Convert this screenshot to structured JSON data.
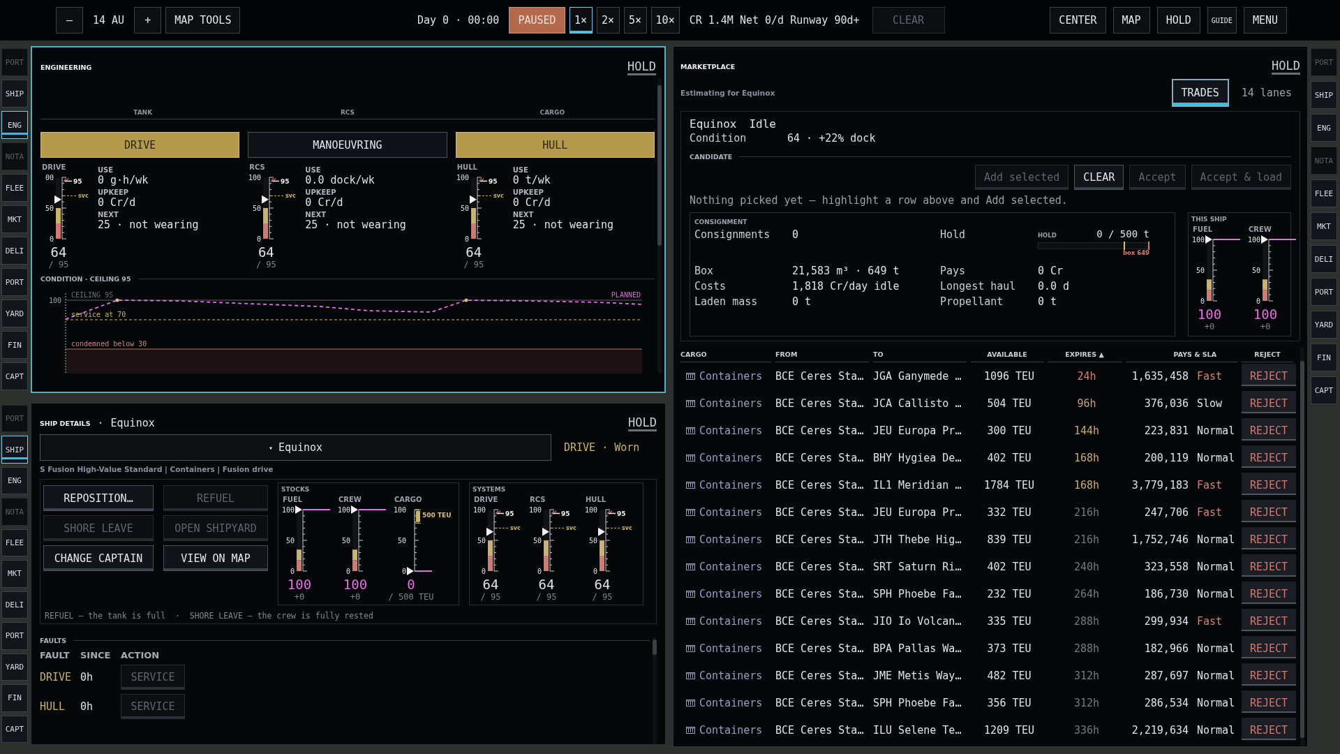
{
  "topbar": {
    "zoom_out": "–",
    "scale": "14 AU",
    "zoom_in": "+",
    "map_tools": "MAP TOOLS",
    "clock": "Day 0 · 00:00",
    "pause": {
      "label": "PAUSED",
      "on": true
    },
    "speeds": [
      {
        "label": "1×",
        "selected": true
      },
      {
        "label": "2×",
        "selected": false
      },
      {
        "label": "5×",
        "selected": false
      },
      {
        "label": "10×",
        "selected": false
      }
    ],
    "finance": "CR 1.4M Net 0/d Runway 90d+",
    "clear": {
      "label": "CLEAR",
      "disabled": true
    },
    "actions": [
      {
        "label": "CENTER",
        "kind": "normal"
      },
      {
        "label": "MAP",
        "kind": "normal"
      },
      {
        "label": "HOLD",
        "kind": "normal"
      },
      {
        "label": "GUIDE",
        "kind": "small"
      },
      {
        "label": "MENU",
        "kind": "normal"
      }
    ]
  },
  "left_sidebar_top": {
    "items": [
      {
        "label": "PORT",
        "disabled": true,
        "selected": false
      },
      {
        "label": "SHIP",
        "disabled": false,
        "selected": false
      },
      {
        "label": "ENG",
        "disabled": false,
        "selected": true
      },
      {
        "label": "NOTA",
        "disabled": true,
        "selected": false
      },
      {
        "label": "FLEE",
        "disabled": false,
        "selected": false
      },
      {
        "label": "MKT",
        "disabled": false,
        "selected": false
      },
      {
        "label": "DELI",
        "disabled": false,
        "selected": false
      },
      {
        "label": "PORT",
        "disabled": false,
        "selected": false
      },
      {
        "label": "YARD",
        "disabled": false,
        "selected": false
      },
      {
        "label": "FIN",
        "disabled": false,
        "selected": false
      },
      {
        "label": "CAPT",
        "disabled": false,
        "selected": false
      }
    ]
  },
  "engineering": {
    "title": "ENGINEERING",
    "hold": "HOLD",
    "focused": true,
    "columns": [
      "TANK",
      "RCS",
      "CARGO"
    ],
    "modes": [
      {
        "label": "DRIVE",
        "on": true
      },
      {
        "label": "MANOEUVRING",
        "on": false
      },
      {
        "label": "HULL",
        "on": true
      }
    ],
    "systems": [
      {
        "gauge": {
          "kind": "system",
          "label": "DRIVE",
          "ticks": [
            "00",
            "50",
            "0"
          ],
          "cap": "95",
          "service": "svc",
          "pointer": {
            "level": 0.64
          },
          "bar": {
            "level": 0.5
          },
          "value": "64",
          "sub": "/ 95"
        },
        "fields": [
          {
            "label": "USE",
            "value": "0 g·h/wk"
          },
          {
            "label": "UPKEEP",
            "value": "0 Cr/d"
          },
          {
            "label": "NEXT",
            "value": "25 · not wearing"
          }
        ]
      },
      {
        "gauge": {
          "kind": "system",
          "label": "RCS",
          "ticks": [
            "100",
            "50",
            "0"
          ],
          "cap": "95",
          "service": "svc",
          "pointer": {
            "level": 0.64
          },
          "bar": {
            "level": 0.5
          },
          "value": "64",
          "sub": "/ 95"
        },
        "fields": [
          {
            "label": "USE",
            "value": "0.0 dock/wk"
          },
          {
            "label": "UPKEEP",
            "value": "0 Cr/d"
          },
          {
            "label": "NEXT",
            "value": "25 · not wearing"
          }
        ]
      },
      {
        "gauge": {
          "kind": "system",
          "label": "HULL",
          "ticks": [
            "100",
            "50",
            "0"
          ],
          "cap": "95",
          "service": "svc",
          "pointer": {
            "level": 0.64
          },
          "bar": {
            "level": 0.5
          },
          "value": "64",
          "sub": "/ 95"
        },
        "fields": [
          {
            "label": "USE",
            "value": "0 t/wk"
          },
          {
            "label": "UPKEEP",
            "value": "0 Cr/d"
          },
          {
            "label": "NEXT",
            "value": "25 · not wearing"
          }
        ]
      }
    ],
    "condition": {
      "title": "CONDITION · CEILING 95",
      "axis_label": "100",
      "ceiling": "CEILING 95",
      "service": "service at 70",
      "condemned": "condemned below 30",
      "planned": "PLANNED"
    }
  },
  "left_sidebar_bottom": {
    "items": [
      {
        "label": "PORT",
        "disabled": true,
        "selected": false
      },
      {
        "label": "SHIP",
        "disabled": false,
        "selected": true
      },
      {
        "label": "ENG",
        "disabled": false,
        "selected": false
      },
      {
        "label": "NOTA",
        "disabled": true,
        "selected": false
      },
      {
        "label": "FLEE",
        "disabled": false,
        "selected": false
      },
      {
        "label": "MKT",
        "disabled": false,
        "selected": false
      },
      {
        "label": "DELI",
        "disabled": false,
        "selected": false
      },
      {
        "label": "PORT",
        "disabled": false,
        "selected": false
      },
      {
        "label": "YARD",
        "disabled": false,
        "selected": false
      },
      {
        "label": "FIN",
        "disabled": false,
        "selected": false
      },
      {
        "label": "CAPT",
        "disabled": false,
        "selected": false
      }
    ]
  },
  "ship_details": {
    "title": "SHIP DETAILS",
    "separator": "·",
    "name": "Equinox",
    "hold": "HOLD",
    "focused": false,
    "selector": {
      "caret": "▾",
      "value": "Equinox"
    },
    "status": "DRIVE · Worn",
    "subtitle": "S Fusion High-Value Standard | Containers | Fusion drive",
    "actions": [
      {
        "label": "REPOSITION…",
        "disabled": false
      },
      {
        "label": "REFUEL",
        "disabled": true
      },
      {
        "label": "SHORE LEAVE",
        "disabled": true
      },
      {
        "label": "OPEN SHIPYARD",
        "disabled": true
      },
      {
        "label": "CHANGE CAPTAIN",
        "disabled": false
      },
      {
        "label": "VIEW ON MAP",
        "disabled": false
      }
    ],
    "stocks": {
      "title": "STOCKS",
      "gauges": [
        {
          "kind": "stock",
          "label": "FUEL",
          "ticks": [
            "100",
            "50",
            "0"
          ],
          "pointer": {
            "level": 1
          },
          "bar": {
            "level": 0.35
          },
          "value": "100",
          "sub": "+0"
        },
        {
          "kind": "stock",
          "label": "CREW",
          "ticks": [
            "100",
            "50",
            "0"
          ],
          "pointer": {
            "level": 1
          },
          "bar": {
            "level": 0.35
          },
          "value": "100",
          "sub": "+0"
        },
        {
          "kind": "cargo",
          "label": "CARGO",
          "ticks": [
            "100",
            "50",
            "0"
          ],
          "pointer": {
            "level": 0
          },
          "capacity": "500 TEU",
          "value": "0",
          "sub": "/ 500 TEU"
        }
      ]
    },
    "systems": {
      "title": "SYSTEMS",
      "gauges": [
        {
          "kind": "system",
          "label": "DRIVE",
          "ticks": [
            "100",
            "50",
            "0"
          ],
          "cap": "95",
          "service": "svc",
          "pointer": {
            "level": 0.64
          },
          "bar": {
            "level": 0.5
          },
          "value": "64",
          "sub": "/ 95"
        },
        {
          "kind": "system",
          "label": "RCS",
          "ticks": [
            "100",
            "50",
            "0"
          ],
          "cap": "95",
          "service": "svc",
          "pointer": {
            "level": 0.64
          },
          "bar": {
            "level": 0.5
          },
          "value": "64",
          "sub": "/ 95"
        },
        {
          "kind": "system",
          "label": "HULL",
          "ticks": [
            "100",
            "50",
            "0"
          ],
          "cap": "95",
          "service": "svc",
          "pointer": {
            "level": 0.64
          },
          "bar": {
            "level": 0.5
          },
          "value": "64",
          "sub": "/ 95"
        }
      ]
    },
    "note": "REFUEL — the tank is full  ·  SHORE LEAVE — the crew is fully rested",
    "faults": {
      "title": "FAULTS",
      "columns": [
        "FAULT",
        "SINCE",
        "ACTION"
      ],
      "rows": [
        {
          "fault": "DRIVE",
          "since": "0h",
          "action": "SERVICE",
          "disabled": true
        },
        {
          "fault": "HULL",
          "since": "0h",
          "action": "SERVICE",
          "disabled": true
        }
      ]
    }
  },
  "marketplace": {
    "title": "MARKETPLACE",
    "hold": "HOLD",
    "focused": false,
    "subtitle": "Estimating for Equinox",
    "tabs": [
      {
        "label": "TRADES",
        "selected": true
      }
    ],
    "lanes": "14 lanes",
    "ship": {
      "name": "Equinox",
      "state": "Idle",
      "condition_label": "Condition",
      "condition": "64 · +22% dock"
    },
    "candidate": {
      "title": "CANDIDATE",
      "buttons": [
        {
          "label": "Add selected",
          "disabled": true
        },
        {
          "label": "CLEAR",
          "disabled": false
        },
        {
          "label": "Accept",
          "disabled": true
        },
        {
          "label": "Accept & load",
          "disabled": true
        }
      ],
      "note": "Nothing picked yet — highlight a row above and Add selected."
    },
    "consignment": {
      "title": "CONSIGNMENT",
      "cells": [
        {
          "label": "Consignments",
          "value": "0"
        },
        {
          "label": "Hold",
          "meter": {
            "title": "HOLD",
            "reading": "0 / 500 t",
            "marker": "box 649"
          }
        },
        {
          "label": "Box",
          "value": "21,583 m³ · 649 t"
        },
        {
          "label": "Pays",
          "value": "0 Cr"
        },
        {
          "label": "Costs",
          "value": "1,818 Cr/day idle"
        },
        {
          "label": "Longest haul",
          "value": "0.0 d"
        },
        {
          "label": "Laden mass",
          "value": "0 t"
        },
        {
          "label": "Propellant",
          "value": "0 t"
        }
      ]
    },
    "this_ship": {
      "title": "THIS SHIP",
      "gauges": [
        {
          "kind": "stock",
          "label": "FUEL",
          "ticks": [
            "100",
            "50",
            "0"
          ],
          "pointer": {
            "level": 1
          },
          "bar": {
            "level": 0.35
          },
          "value": "100",
          "sub": "+0"
        },
        {
          "kind": "stock",
          "label": "CREW",
          "ticks": [
            "100",
            "50",
            "0"
          ],
          "pointer": {
            "level": 1
          },
          "bar": {
            "level": 0.35
          },
          "value": "100",
          "sub": "+0"
        }
      ]
    },
    "table": {
      "columns": [
        "CARGO",
        "FROM",
        "TO",
        "AVAILABLE",
        "EXPIRES ▲",
        "PAYS & SLA",
        "REJECT"
      ],
      "rows": [
        {
          "cargo": "Containers",
          "from": "BCE Ceres Sta…",
          "to": "JGA Ganymede …",
          "available": "1096 TEU",
          "expires": "24h",
          "color": "#d98070",
          "pays": "1,635,458",
          "sla": "Fast",
          "sla_fast": true,
          "action": "REJECT"
        },
        {
          "cargo": "Containers",
          "from": "BCE Ceres Sta…",
          "to": "JCA Callisto …",
          "available": "504 TEU",
          "expires": "96h",
          "color": "#c4a088",
          "pays": "376,036",
          "sla": "Slow",
          "sla_fast": false,
          "action": "REJECT"
        },
        {
          "cargo": "Containers",
          "from": "BCE Ceres Sta…",
          "to": "JEU Europa Pr…",
          "available": "300 TEU",
          "expires": "144h",
          "color": "#c8aa78",
          "pays": "223,831",
          "sla": "Normal",
          "sla_fast": false,
          "action": "REJECT"
        },
        {
          "cargo": "Containers",
          "from": "BCE Ceres Sta…",
          "to": "BHY Hygiea De…",
          "available": "402 TEU",
          "expires": "168h",
          "color": "#c8aa78",
          "pays": "200,119",
          "sla": "Normal",
          "sla_fast": false,
          "action": "REJECT"
        },
        {
          "cargo": "Containers",
          "from": "BCE Ceres Sta…",
          "to": "IL1 Meridian …",
          "available": "1784 TEU",
          "expires": "168h",
          "color": "#c8aa78",
          "pays": "3,779,183",
          "sla": "Fast",
          "sla_fast": true,
          "action": "REJECT"
        },
        {
          "cargo": "Containers",
          "from": "BCE Ceres Sta…",
          "to": "JEU Europa Pr…",
          "available": "332 TEU",
          "expires": "216h",
          "color": "#747986",
          "pays": "247,706",
          "sla": "Fast",
          "sla_fast": true,
          "action": "REJECT"
        },
        {
          "cargo": "Containers",
          "from": "BCE Ceres Sta…",
          "to": "JTH Thebe Hig…",
          "available": "839 TEU",
          "expires": "216h",
          "color": "#747986",
          "pays": "1,752,746",
          "sla": "Normal",
          "sla_fast": false,
          "action": "REJECT"
        },
        {
          "cargo": "Containers",
          "from": "BCE Ceres Sta…",
          "to": "SRT Saturn Ri…",
          "available": "402 TEU",
          "expires": "240h",
          "color": "#747986",
          "pays": "323,558",
          "sla": "Normal",
          "sla_fast": false,
          "action": "REJECT"
        },
        {
          "cargo": "Containers",
          "from": "BCE Ceres Sta…",
          "to": "SPH Phoebe Fa…",
          "available": "232 TEU",
          "expires": "264h",
          "color": "#747986",
          "pays": "186,730",
          "sla": "Normal",
          "sla_fast": false,
          "action": "REJECT"
        },
        {
          "cargo": "Containers",
          "from": "BCE Ceres Sta…",
          "to": "JIO Io Volcan…",
          "available": "335 TEU",
          "expires": "288h",
          "color": "#747986",
          "pays": "299,934",
          "sla": "Fast",
          "sla_fast": true,
          "action": "REJECT"
        },
        {
          "cargo": "Containers",
          "from": "BCE Ceres Sta…",
          "to": "BPA Pallas Wa…",
          "available": "373 TEU",
          "expires": "288h",
          "color": "#747986",
          "pays": "182,966",
          "sla": "Normal",
          "sla_fast": false,
          "action": "REJECT"
        },
        {
          "cargo": "Containers",
          "from": "BCE Ceres Sta…",
          "to": "JME Metis Way…",
          "available": "482 TEU",
          "expires": "312h",
          "color": "#747986",
          "pays": "287,697",
          "sla": "Normal",
          "sla_fast": false,
          "action": "REJECT"
        },
        {
          "cargo": "Containers",
          "from": "BCE Ceres Sta…",
          "to": "SPH Phoebe Fa…",
          "available": "356 TEU",
          "expires": "312h",
          "color": "#747986",
          "pays": "286,534",
          "sla": "Normal",
          "sla_fast": false,
          "action": "REJECT"
        },
        {
          "cargo": "Containers",
          "from": "BCE Ceres Sta…",
          "to": "ILU Selene Te…",
          "available": "1209 TEU",
          "expires": "336h",
          "color": "#747986",
          "pays": "2,219,634",
          "sla": "Normal",
          "sla_fast": false,
          "action": "REJECT"
        }
      ]
    }
  },
  "right_sidebar": {
    "items": [
      {
        "label": "PORT",
        "disabled": true,
        "selected": false
      },
      {
        "label": "SHIP",
        "disabled": false,
        "selected": false
      },
      {
        "label": "ENG",
        "disabled": false,
        "selected": false
      },
      {
        "label": "NOTA",
        "disabled": true,
        "selected": false
      },
      {
        "label": "FLEE",
        "disabled": false,
        "selected": false
      },
      {
        "label": "MKT",
        "disabled": false,
        "selected": false
      },
      {
        "label": "DELI",
        "disabled": false,
        "selected": false
      },
      {
        "label": "PORT",
        "disabled": false,
        "selected": false
      },
      {
        "label": "YARD",
        "disabled": false,
        "selected": false
      },
      {
        "label": "FIN",
        "disabled": false,
        "selected": false
      },
      {
        "label": "CAPT",
        "disabled": false,
        "selected": false
      }
    ]
  }
}
